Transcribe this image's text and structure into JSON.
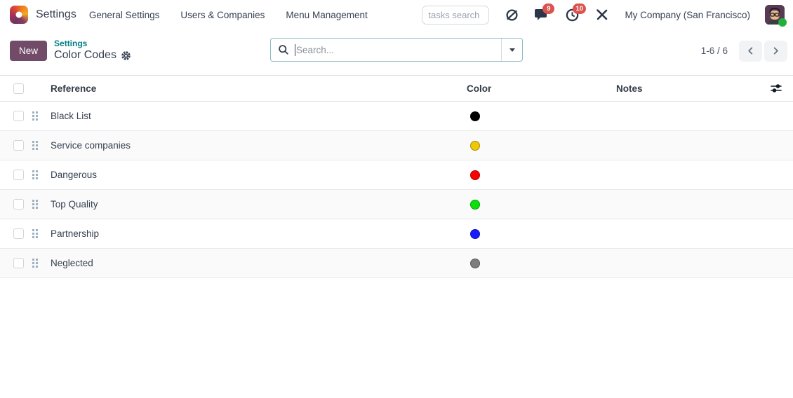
{
  "navbar": {
    "app_name": "Settings",
    "menu": [
      "General Settings",
      "Users & Companies",
      "Menu Management"
    ],
    "tasks_search_placeholder": "tasks search",
    "messages_badge": "9",
    "activities_badge": "10",
    "company": "My Company (San Francisco)",
    "icons": [
      "discuss-icon",
      "messages-icon",
      "activities-icon",
      "tools-icon"
    ]
  },
  "panel": {
    "new_label": "New",
    "breadcrumb_parent": "Settings",
    "breadcrumb_current": "Color Codes",
    "search_placeholder": "Search...",
    "pager_text": "1-6 / 6",
    "pager_prev": "prev",
    "pager_next": "next"
  },
  "table": {
    "headers": {
      "reference": "Reference",
      "color": "Color",
      "notes": "Notes"
    },
    "rows": [
      {
        "reference": "Black List",
        "color_name": "black",
        "color_hex": "#000000",
        "notes": ""
      },
      {
        "reference": "Service companies",
        "color_name": "yellow",
        "color_hex": "#EFC707",
        "notes": ""
      },
      {
        "reference": "Dangerous",
        "color_name": "red",
        "color_hex": "#FF0000",
        "notes": ""
      },
      {
        "reference": "Top Quality",
        "color_name": "green",
        "color_hex": "#0AE00A",
        "notes": ""
      },
      {
        "reference": "Partnership",
        "color_name": "blue",
        "color_hex": "#1A1AFF",
        "notes": ""
      },
      {
        "reference": "Neglected",
        "color_name": "gray",
        "color_hex": "#7D7D7D",
        "notes": ""
      }
    ]
  },
  "colors": {
    "brand_purple": "#714B67",
    "link_teal": "#017E84",
    "badge_red": "#d9534f",
    "stripe_bg": "#fafafa",
    "search_border": "#8cbdc1"
  }
}
